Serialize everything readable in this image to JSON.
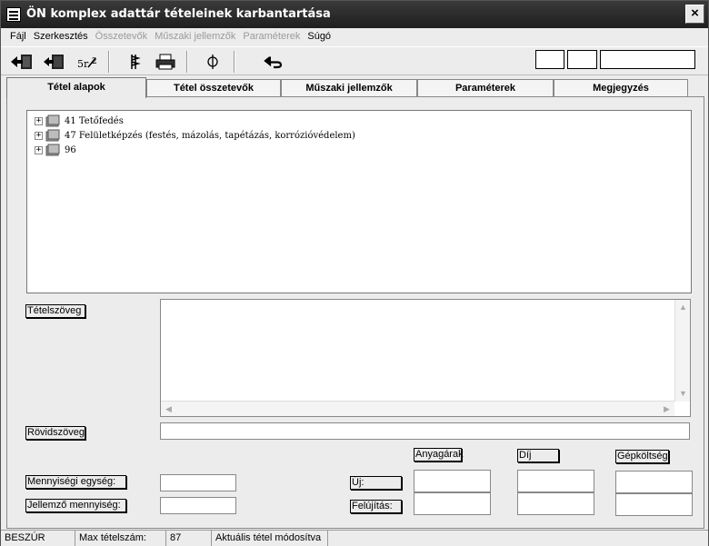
{
  "window": {
    "title": "ÖN komplex adattár tételeinek karbantartása",
    "close_label": "×"
  },
  "menu": [
    {
      "label": "Fájl",
      "enabled": true
    },
    {
      "label": "Szerkesztés",
      "enabled": true
    },
    {
      "label": "Összetevők",
      "enabled": false
    },
    {
      "label": "Műszaki jellemzők",
      "enabled": false
    },
    {
      "label": "Paraméterek",
      "enabled": false
    },
    {
      "label": "Súgó",
      "enabled": true
    }
  ],
  "toolbar": {
    "buttons": [
      {
        "icon": "exit-door-icon"
      },
      {
        "icon": "door-back-icon"
      },
      {
        "icon": "fraction-icon",
        "text": "5/2"
      },
      {
        "icon": "column-icon"
      },
      {
        "icon": "printer-icon"
      },
      {
        "icon": "phi-icon",
        "text": "φ"
      },
      {
        "icon": "undo-arrow-icon"
      }
    ]
  },
  "tabs": [
    {
      "label": "Tétel alapok",
      "active": true
    },
    {
      "label": "Tétel összetevők",
      "active": false
    },
    {
      "label": "Műszaki jellemzők",
      "active": false
    },
    {
      "label": "Paraméterek",
      "active": false
    },
    {
      "label": "Megjegyzés",
      "active": false
    }
  ],
  "tree": {
    "items": [
      {
        "expander": "+",
        "label": "41 Tetőfedés"
      },
      {
        "expander": "+",
        "label": "47 Felületképzés (festés, mázolás, tapétázás, korrózióvédelem)"
      },
      {
        "expander": "+",
        "label": "96"
      }
    ]
  },
  "form": {
    "tetelszoveg_label": "Tételszöveg",
    "tetelszoveg_value": "",
    "rovidszoveg_label": "Rövidszöveg",
    "rovidszoveg_value": "",
    "mennyisegi_egyseg_label": "Mennyiségi egység:",
    "mennyisegi_egyseg_value": "",
    "jellemzo_mennyiseg_label": "Jellemző mennyiség:",
    "jellemzo_mennyiseg_value": "",
    "uj_label": "Új:",
    "felujitas_label": "Felújítás:",
    "anyagarak_label": "Anyagárak",
    "dij_label": "Díj",
    "gepkoltseg_label": "Gépköltség"
  },
  "status": {
    "mode": "BESZÚR",
    "max_label": "Max tételszám:",
    "max_value": "87",
    "message": "Aktuális tétel módosítva"
  }
}
